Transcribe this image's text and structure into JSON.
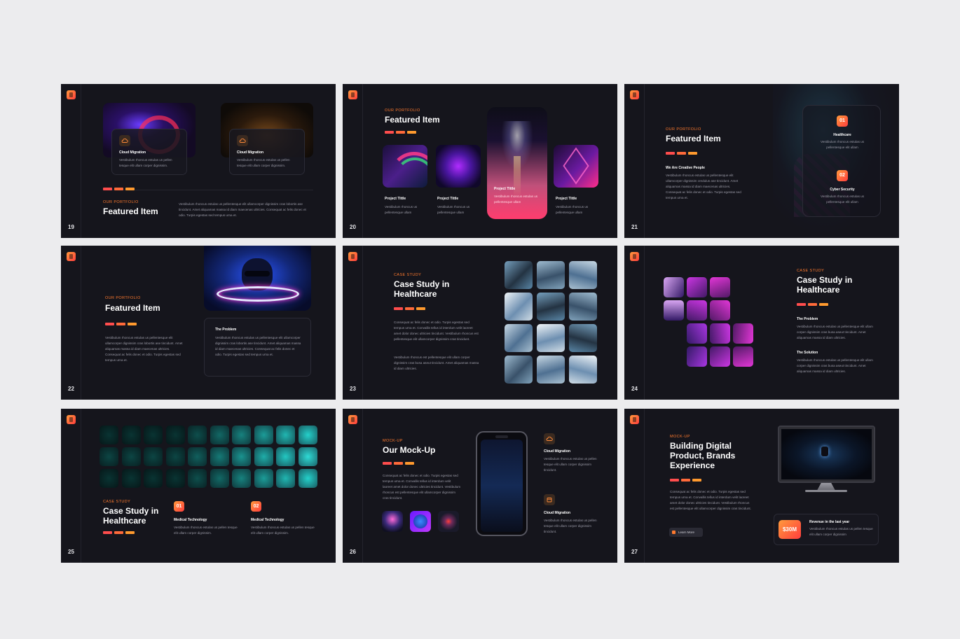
{
  "slides": [
    {
      "num": "19",
      "eyebrow": "OUR PORTFOLIO",
      "title": "Featured Item",
      "cards": [
        {
          "title": "Cloud Migration",
          "text": "Vestibulum rhoncus estulas us pellen tesque elit ullam corper dignissim."
        },
        {
          "title": "Cloud Migration",
          "text": "Vestibulum rhoncus estulas us pellen tesque elit ullam corper dignissim."
        }
      ],
      "body": "Vestibulum rhoncus estulas us pellentesque elit ullamcorper dignissim cras lobortis ase tincidunt. Amet aliquamas massa id diam maecenas ultricies. Consequat ac felis donec et odio. Turpis egestas sed tempus urna et."
    },
    {
      "num": "20",
      "eyebrow": "OUR PORTFOLIO",
      "title": "Featured Item",
      "projects": [
        {
          "title": "Project Tittle",
          "text": "Vestibulum rhoncus us pellentesque ullam"
        },
        {
          "title": "Project Tittle",
          "text": "Vestibulum rhoncus us pellentesque ullam"
        },
        {
          "title": "Project Tittle",
          "text": "Vestibulum rhoncus estulas us pellentesque ullam"
        },
        {
          "title": "Project Tittle",
          "text": "Vestibulum rhoncus us pellentesque ullam"
        }
      ]
    },
    {
      "num": "21",
      "eyebrow": "OUR PORTFOLIO",
      "title": "Featured Item",
      "sub": "We Are Creative People",
      "body": "Vestibulum rhoncus estulas us pellentesque elit ullamcorper dignissim credulus ase tincidunt. Amet aliquamas massa id diam maecenas ultricies. Consequat ac felis donec et odio. Turpis egestas sed tempus urna et.",
      "items": [
        {
          "badge": "01",
          "title": "Healthcare",
          "text": "Vestibulum rhoncus estulas us pellentesque elit ullam"
        },
        {
          "badge": "02",
          "title": "Cyber Security",
          "text": "Vestibulum rhoncus estulas us pellentesque elit ullam"
        }
      ]
    },
    {
      "num": "22",
      "eyebrow": "OUR PORTFOLIO",
      "title": "Featured Item",
      "body": "Vestibulum rhoncus estulas us pellentesque elit ullamcorper dignissim cras lobortis ase tincidunt. Amet aliquamas massa id diam maecenas ultricies. Consequat ac felis donec et odio. Turpis egestas sed tempus urna et.",
      "card_title": "The Problem",
      "card_text": "Vestibulum rhoncus estulas us pellentesque elit ullamcorper dignissim cras lobortis ase tincidunt. Amet aliquamas massa id diam maecenas ultricies. Consequat ac felis donec et odio. Turpis egestas sed tempus urna et."
    },
    {
      "num": "23",
      "eyebrow": "CASE STUDY",
      "title": "Case Study in Healthcare",
      "body1": "Consequat ac felis donec et odio. Turpis egestas sed tempus urna et. Convallis tellus id interdum velit laoreet amet dolor donec ultricies tincidunt. Vestibulum rhoncus est pellentesque elit ullamcorper dignissim cras tincidunt.",
      "body2": "Vestibulum rhoncus est pellentesque elit ullam corper dignissim cras busa aseut tincidunt. Amet aliquamas massa id diam ultricies."
    },
    {
      "num": "24",
      "eyebrow": "CASE STUDY",
      "title": "Case Study in Healthcare",
      "sub1": "The Problem",
      "text1": "Vestibulum rhoncus estulas us pellentesque elit ullam corper dignissim cras busa aseut tincidunt. Amet aliquamas massa id diam ultricies.",
      "sub2": "The Solution",
      "text2": "Vestibulum rhoncus estulas us pellentesque elit ullam corper dignissim cras busa aseut tincidunt. Amet aliquamas massa id diam ultricies."
    },
    {
      "num": "25",
      "eyebrow": "CASE STUDY",
      "title": "Case Study in Healthcare",
      "items": [
        {
          "badge": "01",
          "title": "Medical Technology",
          "text": "Vestibulum rhoncus estulas us pellen tesque elit ullam corper dignissim."
        },
        {
          "badge": "02",
          "title": "Medical Technology",
          "text": "Vestibulum rhoncus estulas us pellen tesque elit ullam corper dignissim."
        }
      ]
    },
    {
      "num": "26",
      "eyebrow": "MOCK-UP",
      "title": "Our Mock-Up",
      "body": "Consequat ac felis donec et odio. Turpis egestas sed tempus urna et. Convallis tellus id interdum velit laoreet amet dolor donec ultricies tincidunt. Vestibulum rhoncus est pellentesque elit ullamcorper dignissim cras tincidunt.",
      "items": [
        {
          "title": "Cloud Migration",
          "text": "Vestibulum rhoncus estulas us pellen tesque elit ullam corper dignissim tincidunt."
        },
        {
          "title": "Cloud Migration",
          "text": "Vestibulum rhoncus estulas us pellen tesque elit ullam corper dignissim tincidunt."
        }
      ]
    },
    {
      "num": "27",
      "eyebrow": "MOCK-UP",
      "title": "Building Digital Product, Brands Experience",
      "body": "Consequat ac felis donec et odio. Turpis egestas sed tempus urna et. Convallis tellus id interdum velit laoreet amet dolor donec ultricies tincidunt. Vestibulum rhoncus est pellentesque elit ullamcorper dignissim cras tincidunt.",
      "button": "Learn More",
      "stat": "$30M",
      "stat_title": "Revenue in the last year",
      "stat_text": "Vestibulum rhoncus estulas us pellen tesque elit ullam corper dignissim"
    }
  ]
}
